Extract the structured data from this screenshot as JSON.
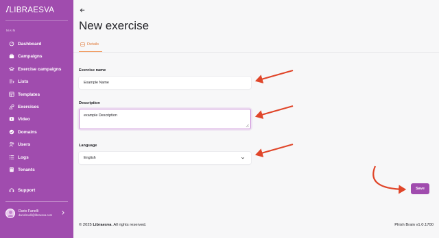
{
  "sidebar": {
    "logo": "LIBRAESVA",
    "section_label": "MAIN",
    "items": [
      {
        "label": "Dashboard",
        "icon": "dashboard-icon"
      },
      {
        "label": "Campaigns",
        "icon": "briefcase-icon"
      },
      {
        "label": "Exercise campaigns",
        "icon": "graduation-cap-icon"
      },
      {
        "label": "Lists",
        "icon": "list-icon"
      },
      {
        "label": "Templates",
        "icon": "template-icon"
      },
      {
        "label": "Exercises",
        "icon": "shapes-icon"
      },
      {
        "label": "Video",
        "icon": "video-icon"
      },
      {
        "label": "Domains",
        "icon": "check-badge-icon"
      },
      {
        "label": "Users",
        "icon": "users-icon"
      },
      {
        "label": "Logs",
        "icon": "logs-icon"
      },
      {
        "label": "Tenants",
        "icon": "tenants-icon"
      }
    ],
    "support": {
      "label": "Support",
      "icon": "headphones-icon"
    },
    "user": {
      "name": "Dario Fanelli",
      "email": "dariofanelli@libraesva.com"
    }
  },
  "header": {
    "title": "New exercise"
  },
  "tabs": [
    {
      "label": "Details",
      "active": true
    }
  ],
  "form": {
    "exercise_name": {
      "label": "Exercise name",
      "value": "Example Name"
    },
    "description": {
      "label": "Description",
      "value": "example Description"
    },
    "language": {
      "label": "Language",
      "value": "English"
    },
    "save_label": "Save"
  },
  "footer": {
    "copyright_prefix": "© 2025 ",
    "brand": "Libraesva",
    "copyright_suffix": ". All rights reserved.",
    "version": "Phish Brain v1.0.1700"
  },
  "colors": {
    "brand": "#a04cae",
    "accent_tab": "#e07a38",
    "annotation_arrow": "#e0462a"
  }
}
